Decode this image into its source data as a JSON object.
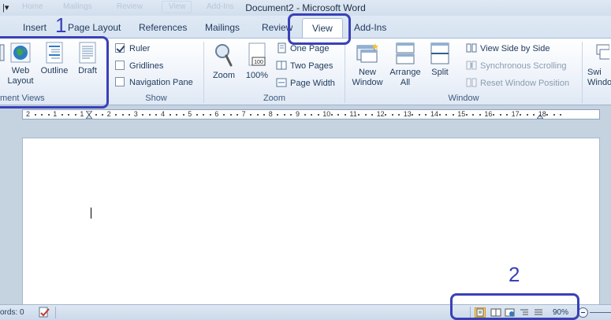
{
  "window": {
    "title": "Document2  -  Microsoft Word",
    "ghost_tabs": [
      "Home",
      "Mailings",
      "Review",
      "View",
      "Add-Ins"
    ]
  },
  "tabs": [
    {
      "label": "Insert"
    },
    {
      "label": "Page Layout"
    },
    {
      "label": "References"
    },
    {
      "label": "Mailings"
    },
    {
      "label": "Review"
    },
    {
      "label": "View",
      "active": true
    },
    {
      "label": "Add-Ins"
    }
  ],
  "ribbon": {
    "document_views": {
      "label": "ment Views",
      "web_layout": "Web Layout",
      "outline": "Outline",
      "draft": "Draft"
    },
    "show": {
      "label": "Show",
      "ruler": {
        "label": "Ruler",
        "checked": true
      },
      "gridlines": {
        "label": "Gridlines",
        "checked": false
      },
      "navigation_pane": {
        "label": "Navigation Pane",
        "checked": false
      }
    },
    "zoom": {
      "label": "Zoom",
      "zoom": "Zoom",
      "hundred": "100%",
      "hundred_icon_text": "100",
      "one_page": "One Page",
      "two_pages": "Two Pages",
      "page_width": "Page Width"
    },
    "window": {
      "label": "Window",
      "new_window": "New Window",
      "arrange_all": "Arrange All",
      "split": "Split",
      "view_side_by_side": "View Side by Side",
      "synchronous_scrolling": "Synchronous Scrolling",
      "reset_window_position": "Reset Window Position",
      "switch_windows": "Swi Windo"
    }
  },
  "ruler": {
    "numbers": [
      "2",
      "1",
      "1",
      "2",
      "3",
      "4",
      "5",
      "6",
      "7",
      "8",
      "9",
      "10",
      "11",
      "12",
      "13",
      "14",
      "15",
      "16",
      "17",
      "18"
    ]
  },
  "status": {
    "words": "ords: 0",
    "zoom_level": "90%"
  },
  "annotations": {
    "one": "1",
    "two": "2"
  },
  "colors": {
    "annotation": "#3941b8",
    "active_view": "#f7d774"
  }
}
